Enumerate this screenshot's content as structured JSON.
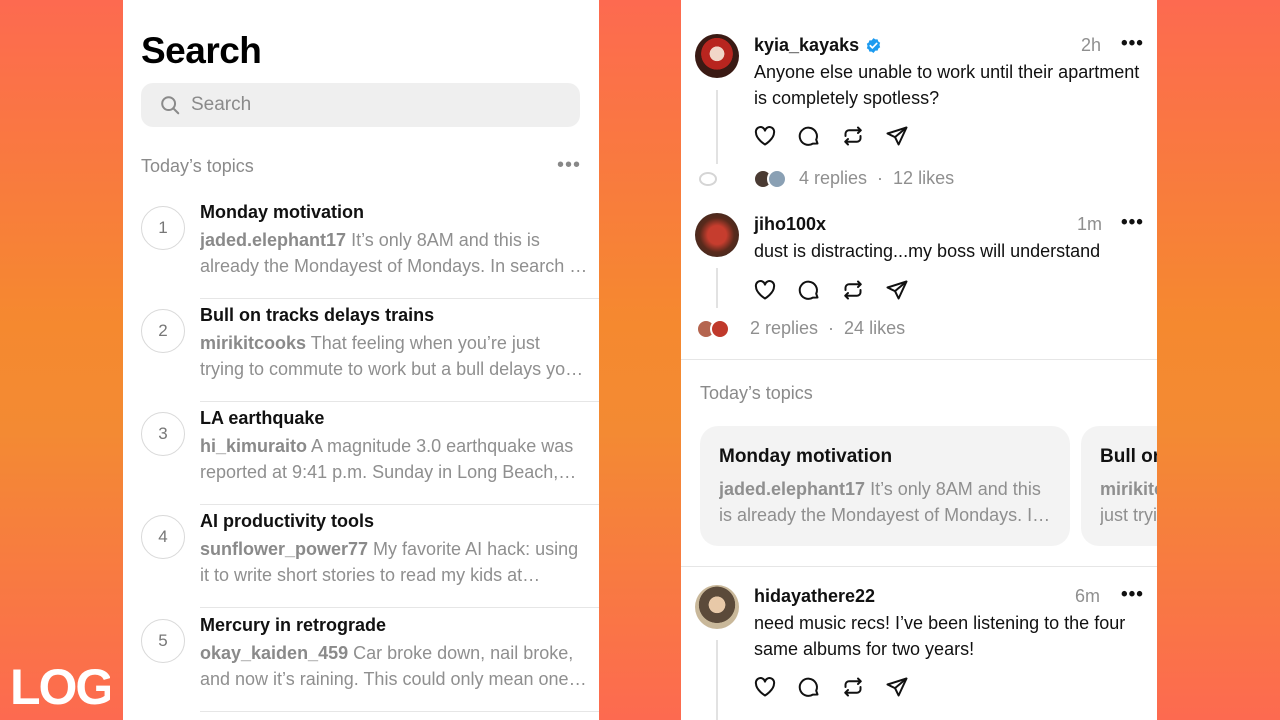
{
  "search_screen": {
    "title": "Search",
    "search_placeholder": "Search",
    "section_title": "Today’s topics",
    "more_label": "•••",
    "topics": [
      {
        "rank": "1",
        "title": "Monday motivation",
        "user": "jaded.elephant17",
        "text": " It’s only 8AM and this is already the Mondayest of Mondays. In search of the energy"
      },
      {
        "rank": "2",
        "title": "Bull on tracks delays trains",
        "user": "mirikitcooks",
        "text": " That feeling when you’re just trying to commute to work but a bull delays your train"
      },
      {
        "rank": "3",
        "title": "LA earthquake",
        "user": "hi_kimuraito",
        "text": " A magnitude 3.0 earthquake was reported at 9:41 p.m. Sunday in Long Beach, California"
      },
      {
        "rank": "4",
        "title": "AI productivity tools",
        "user": "sunflower_power77",
        "text": " My favorite AI hack: using it to write short stories to read my kids at bedtime"
      },
      {
        "rank": "5",
        "title": "Mercury in retrograde",
        "user": "okay_kaiden_459",
        "text": " Car broke down, nail broke, and now it’s raining. This could only mean one thing"
      }
    ]
  },
  "feed_screen": {
    "posts": [
      {
        "username": "kyia_kayaks",
        "verified": true,
        "time": "2h",
        "more": "•••",
        "text": "Anyone else unable to work until their apartment is completely spotless?",
        "replies": "4 replies",
        "separator": "·",
        "likes": "12 likes"
      },
      {
        "username": "jiho100x",
        "verified": false,
        "time": "1m",
        "more": "•••",
        "text": "dust is distracting...my boss will understand",
        "replies": "2 replies",
        "separator": "·",
        "likes": "24 likes"
      },
      {
        "username": "hidayathere22",
        "verified": false,
        "time": "6m",
        "more": "•••",
        "text": "need music recs! I’ve been listening to the four same albums for two years!"
      }
    ],
    "topics_section_title": "Today’s topics",
    "topic_cards": [
      {
        "title": "Monday motivation",
        "user": "jaded.elephant17",
        "text": " It’s only 8AM and this is already the Mondayest of Mondays. In search of the energy"
      },
      {
        "title": "Bull on tracks delays trains",
        "user": "mirikitcooks",
        "text": " That feeling when you’re just trying to commute to work but a bull delays"
      }
    ]
  },
  "icons": [
    "search-icon",
    "verified-icon",
    "heart-icon",
    "comment-icon",
    "repost-icon",
    "share-icon"
  ],
  "colors": {
    "background_top": "#fd6a50",
    "background_mid": "#f5892f",
    "verified": "#1d9bf0",
    "muted_text": "#8f8f8f"
  },
  "watermark": {
    "text": "LOG"
  }
}
